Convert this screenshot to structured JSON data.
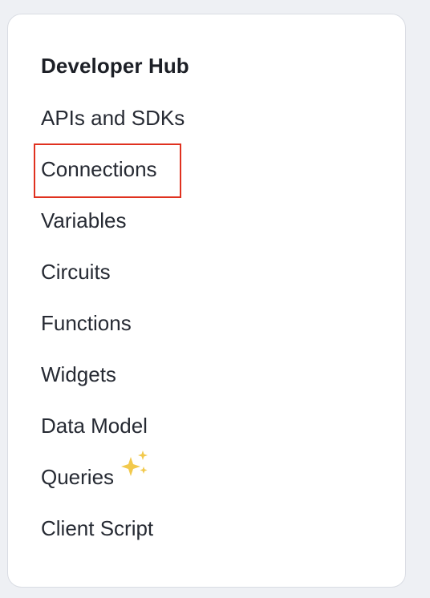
{
  "sidebar": {
    "title": "Developer Hub",
    "items": [
      {
        "label": "APIs and SDKs"
      },
      {
        "label": "Connections"
      },
      {
        "label": "Variables"
      },
      {
        "label": "Circuits"
      },
      {
        "label": "Functions"
      },
      {
        "label": "Widgets"
      },
      {
        "label": "Data Model"
      },
      {
        "label": "Queries",
        "icon": "sparkle-icon"
      },
      {
        "label": "Client Script"
      }
    ],
    "highlighted_item": "Connections"
  },
  "colors": {
    "highlight_border": "#e0311f",
    "sparkle": "#f2c94c",
    "text": "#262a33",
    "heading": "#1c1f26"
  }
}
